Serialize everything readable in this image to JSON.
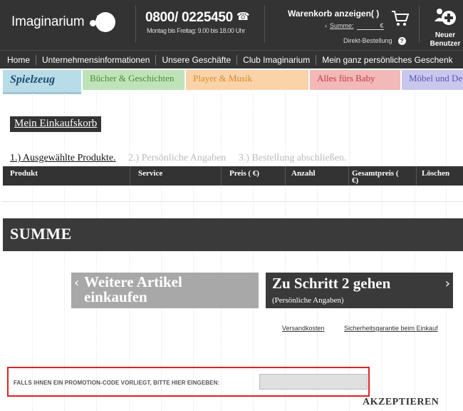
{
  "header": {
    "logo_text": "Imaginarium",
    "phone_number": "0800/ 0225450",
    "phone_hours": "Montag bis Freitag: 9.00 bis 18.00 Uhr",
    "cart_title": "Warenkorb anzeigen( )",
    "cart_sum_arrow": "›",
    "cart_sum_label": "Summe:",
    "cart_sum_value": "€",
    "direct_order_label": "Direkt-Bestellung",
    "help_glyph": "?",
    "new_user_line1": "Neuer",
    "new_user_line2": "Benutzer"
  },
  "nav": {
    "items": [
      "Home",
      "Unternehmensinformationen",
      "Unsere Geschäfte",
      "Club Imaginarium",
      "Mein ganz persönliches Geschenk"
    ]
  },
  "categories": {
    "spielzeug": "Spielzeug",
    "buecher": "Bücher & Geschichten",
    "player": "Player & Musik",
    "baby": "Alles fürs Baby",
    "moebel": "Möbel und De"
  },
  "cart": {
    "heading": "Mein Einkaufskorb",
    "steps": [
      "1.) Ausgewählte Produkte.",
      "2.) Persönliche Angaben",
      "3.) Bestellung abschließen."
    ],
    "columns": {
      "produkt": "Produkt",
      "service": "Service",
      "preis": "Preis ( €)",
      "anzahl": "Anzahl",
      "gesamt1": "Gesamtpreis (",
      "gesamt2": "€)",
      "loeschen": "Löschen"
    },
    "summe": "SUMME"
  },
  "buttons": {
    "more_line1": "Weitere Artikel",
    "more_line2": "einkaufen",
    "more_chevron": "‹",
    "next_title": "Zu Schritt 2 gehen",
    "next_sub": "(Persönliche Angaben)",
    "next_chevron": "›"
  },
  "links": {
    "versand": "Versandkosten",
    "sicherheit": "Sicherheitsgarantie beim Einkauf"
  },
  "promo": {
    "label": "FALLS IHNEN EIN PROMOTION-CODE VORLIEGT, BITTE HIER EINGEBEN:",
    "value": "",
    "accept": "AKZEPTIEREN"
  },
  "colors": {
    "header_bg": "#333333",
    "highlight_border": "#dd2222",
    "tab_spielzeug": "#b9dce9",
    "tab_buecher": "#bfe3b9",
    "tab_player": "#fbd3a8",
    "tab_baby": "#f3b8b8",
    "tab_moebel": "#c9c7ee"
  },
  "icons": {
    "phone": "telephone-icon",
    "cart": "shopping-cart-icon",
    "new_user": "add-user-icon",
    "help": "help-icon"
  }
}
